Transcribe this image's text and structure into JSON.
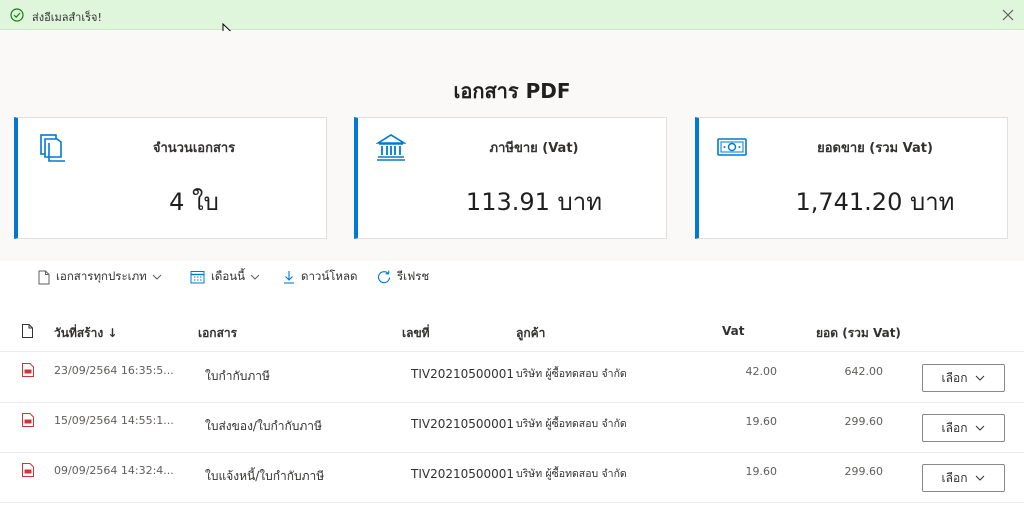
{
  "notification": {
    "message": "ส่งอีเมลสำเร็จ!"
  },
  "page": {
    "title": "เอกสาร PDF"
  },
  "cards": [
    {
      "label": "จำนวนเอกสาร",
      "value": "4 ใบ",
      "icon": "documents-icon"
    },
    {
      "label": "ภาษีขาย (Vat)",
      "value": "113.91 บาท",
      "icon": "bank-icon"
    },
    {
      "label": "ยอดขาย (รวม Vat)",
      "value": "1,741.20 บาท",
      "icon": "money-icon"
    }
  ],
  "toolbar": {
    "doc_type": "เอกสารทุกประเภท",
    "month": "เดือนนี้",
    "download": "ดาวน์โหลด",
    "refresh": "รีเฟรช"
  },
  "table": {
    "headers": {
      "date": "วันที่สร้าง ↓",
      "document": "เอกสาร",
      "number": "เลขที่",
      "customer": "ลูกค้า",
      "vat": "Vat",
      "total": "ยอด (รวม Vat)"
    },
    "select_label": "เลือก",
    "rows": [
      {
        "date": "23/09/2564 16:35:5...",
        "document": "ใบกำกับภาษี",
        "number": "TIV20210500001",
        "customer": "บริษัท ผู้ซื้อทดสอบ จำกัด",
        "vat": "42.00",
        "total": "642.00"
      },
      {
        "date": "15/09/2564 14:55:1...",
        "document": "ใบส่งของ/ใบกำกับภาษี",
        "number": "TIV20210500001",
        "customer": "บริษัท ผู้ซื้อทดสอบ จำกัด",
        "vat": "19.60",
        "total": "299.60"
      },
      {
        "date": "09/09/2564 14:32:4...",
        "document": "ใบแจ้งหนี้/ใบกำกับภาษี",
        "number": "TIV20210500001",
        "customer": "บริษัท ผู้ซื้อทดสอบ จำกัด",
        "vat": "19.60",
        "total": "299.60"
      }
    ]
  },
  "colors": {
    "accent": "#0078d4",
    "success_bg": "#dff6dd",
    "pdf_red": "#d13438"
  }
}
